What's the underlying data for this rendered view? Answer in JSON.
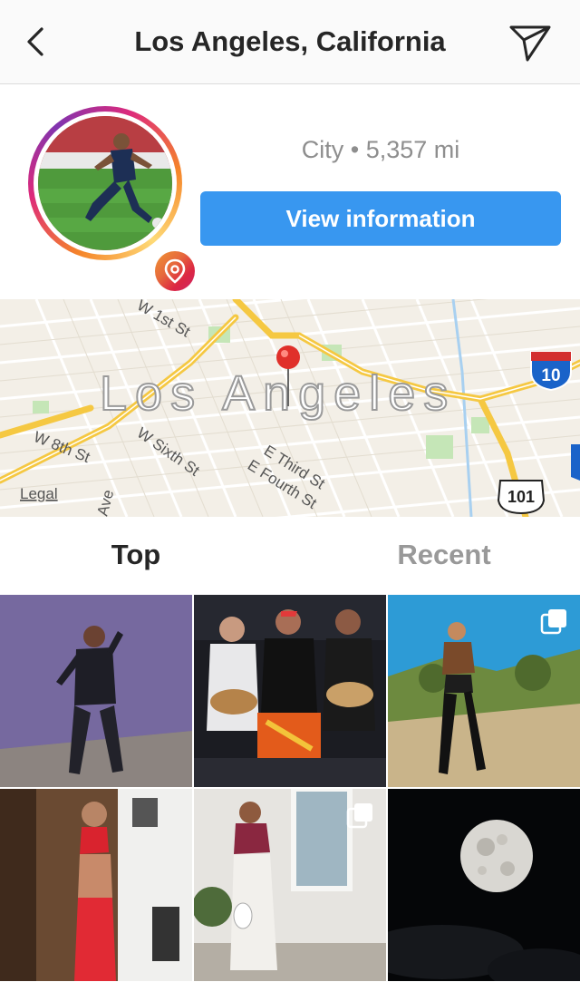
{
  "header": {
    "title": "Los Angeles, California",
    "back_icon": "chevron-left-icon",
    "send_icon": "paper-plane-icon"
  },
  "profile": {
    "meta": "City • 5,357 mi",
    "view_button": "View information",
    "badge_icon": "location-pin-icon"
  },
  "map": {
    "city_label": "Los Angeles",
    "streets": [
      "W 1st St",
      "W 8th St",
      "W Sixth St",
      "E Third St",
      "E Fourth St",
      "Ave"
    ],
    "shields": [
      "10",
      "101"
    ],
    "legal_link": "Legal"
  },
  "tabs": {
    "top": "Top",
    "recent": "Recent"
  },
  "colors": {
    "accent": "#3897f0",
    "muted": "#8e8e8e",
    "pin": "#e0302a"
  }
}
